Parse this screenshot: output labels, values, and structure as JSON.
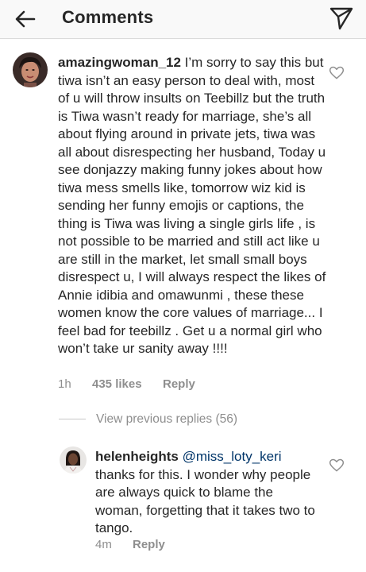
{
  "header": {
    "title": "Comments",
    "back_icon": "arrow-left-icon",
    "send_icon": "paper-plane-icon"
  },
  "comments": [
    {
      "username": "amazingwoman_12",
      "text": " I’m sorry to say this but tiwa isn’t an easy person to deal with, most of u will throw insults on Teebillz but the truth is Tiwa wasn’t ready for marriage, she’s all about flying around in private jets, tiwa was all about disrespecting her husband, Today u see donjazzy making funny jokes about how tiwa mess smells like, tomorrow wiz kid is sending her funny emojis or captions, the thing is Tiwa was living a single girls life , is not possible to be married and still act like u are still in the market, let small small boys disrespect u, I will always respect the likes of Annie idibia and omawunmi , these these women know the core values of marriage... I feel bad for teebillz . Get u a normal girl who won’t take ur sanity away !!!!",
      "time": "1h",
      "likes": "435 likes",
      "reply_label": "Reply"
    }
  ],
  "view_replies": "View previous replies (56)",
  "reply": {
    "username": "helenheights",
    "mention": "@miss_loty_keri",
    "text": "thanks for this. I wonder why people are always quick to blame the woman, forgetting that it takes two to tango.",
    "time": "4m",
    "reply_label": "Reply"
  }
}
